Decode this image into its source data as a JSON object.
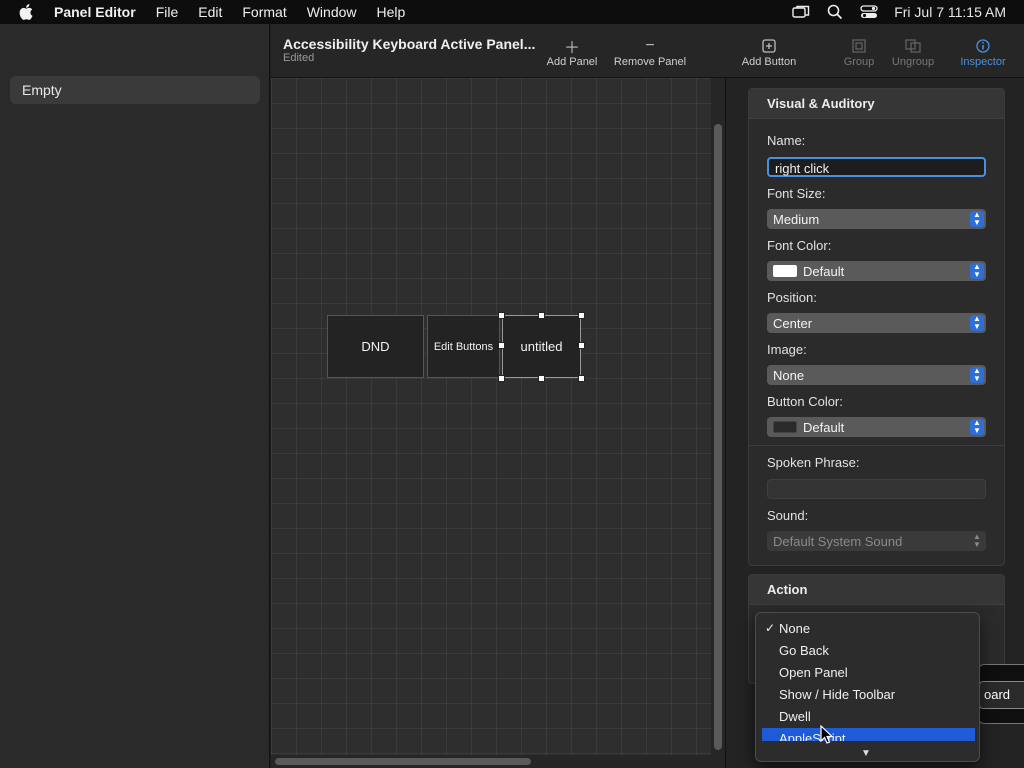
{
  "menubar": {
    "app": "Panel Editor",
    "items": [
      "File",
      "Edit",
      "Format",
      "Window",
      "Help"
    ],
    "clock": "Fri Jul 7  11:15 AM"
  },
  "sidebar": {
    "items": [
      {
        "label": "Empty"
      }
    ]
  },
  "toolbar": {
    "title": "Accessibility Keyboard Active Panel...",
    "subtitle": "Edited",
    "add_panel": "Add Panel",
    "remove_panel": "Remove Panel",
    "add_button": "Add Button",
    "group": "Group",
    "ungroup": "Ungroup",
    "inspector": "Inspector"
  },
  "canvas": {
    "buttons": [
      {
        "label": "DND"
      },
      {
        "label": "Edit Buttons"
      },
      {
        "label": "untitled",
        "selected": true
      }
    ]
  },
  "inspector": {
    "visual": {
      "header": "Visual & Auditory",
      "name_label": "Name:",
      "name_value": "right click",
      "font_size_label": "Font Size:",
      "font_size_value": "Medium",
      "font_color_label": "Font Color:",
      "font_color_value": "Default",
      "font_color_swatch": "#ffffff",
      "position_label": "Position:",
      "position_value": "Center",
      "image_label": "Image:",
      "image_value": "None",
      "button_color_label": "Button Color:",
      "button_color_value": "Default",
      "button_color_swatch": "#2a2a2a",
      "spoken_label": "Spoken Phrase:",
      "spoken_value": "",
      "sound_label": "Sound:",
      "sound_value": "Default System Sound"
    },
    "action": {
      "header": "Action"
    }
  },
  "action_menu": {
    "items": [
      {
        "label": "None",
        "checked": true
      },
      {
        "label": "Go Back"
      },
      {
        "label": "Open Panel"
      },
      {
        "label": "Show / Hide Toolbar"
      },
      {
        "label": "Dwell"
      },
      {
        "label": "AppleScript",
        "highlighted": true
      }
    ]
  },
  "behind_button": {
    "label": "oard"
  },
  "colors": {
    "accent": "#4a90e2",
    "highlight": "#1f5bd6"
  }
}
